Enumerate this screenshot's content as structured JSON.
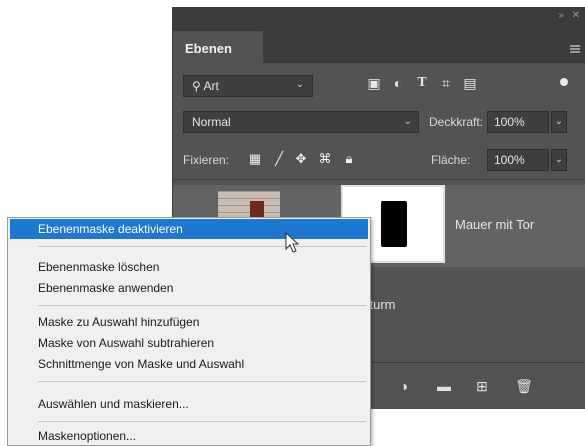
{
  "panel": {
    "tab_label": "Ebenen",
    "filter_type": "Art",
    "blend_mode": "Normal",
    "opacity_label": "Deckkraft:",
    "opacity_value": "100%",
    "lock_label": "Fixieren:",
    "fill_label": "Fläche:",
    "fill_value": "100%"
  },
  "layers": [
    {
      "name": "Mauer mit Tor"
    },
    {
      "name": "itturm"
    }
  ],
  "context_menu": {
    "items": [
      {
        "label": "Ebenenmaske deaktivieren",
        "highlighted": true
      },
      {
        "label": "Ebenenmaske löschen"
      },
      {
        "label": "Ebenenmaske anwenden"
      },
      {
        "label": "Maske zu Auswahl hinzufügen"
      },
      {
        "label": "Maske von Auswahl subtrahieren"
      },
      {
        "label": "Schnittmenge von Maske und Auswahl"
      },
      {
        "label": "Auswählen und maskieren..."
      },
      {
        "label": "Maskenoptionen..."
      }
    ]
  },
  "colors": {
    "panel_bg": "#535353",
    "menu_highlight": "#1e78d2",
    "menu_bg": "#f0f0f0"
  }
}
